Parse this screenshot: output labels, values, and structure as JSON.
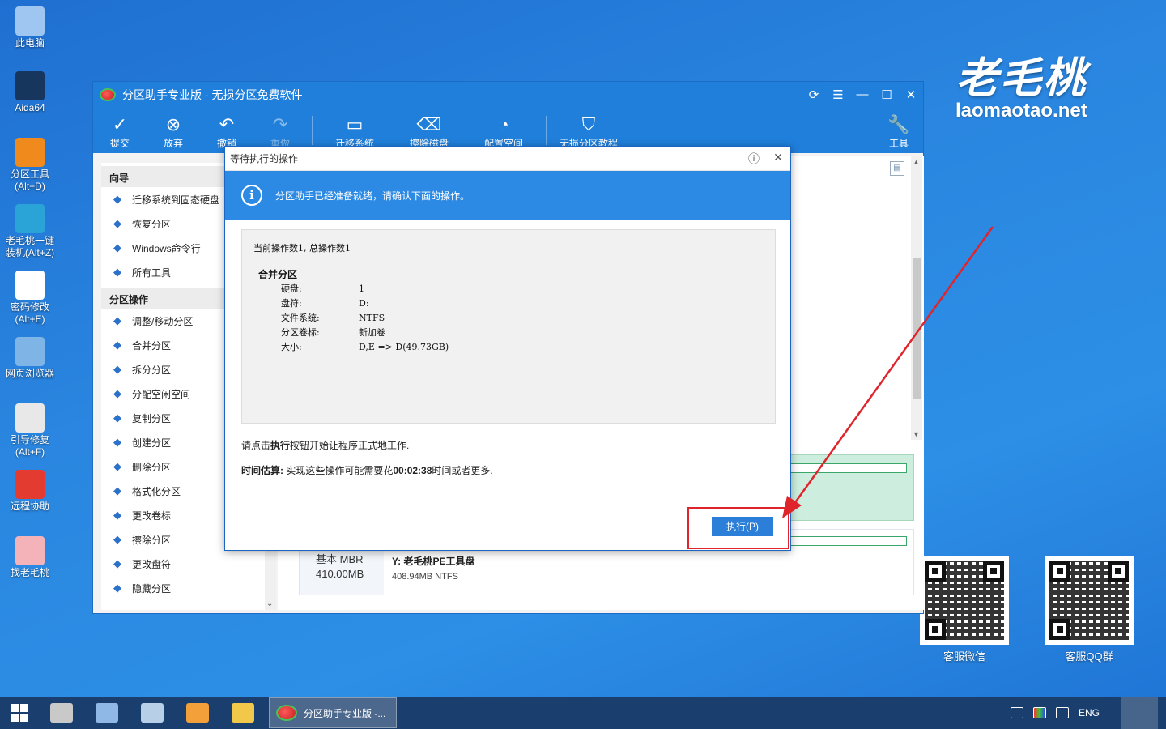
{
  "desktop": {
    "icons": [
      {
        "label": "此电脑",
        "icon": "computer-icon",
        "color": "#9ec6f0"
      },
      {
        "label": "Aida64",
        "icon": "aida64-icon",
        "color": "#16365e"
      },
      {
        "label": "分区工具\n(Alt+D)",
        "icon": "partition-tool-icon",
        "color": "#f08a1c"
      },
      {
        "label": "老毛桃一键\n装机(Alt+Z)",
        "icon": "installer-icon",
        "color": "#2aa3d6"
      },
      {
        "label": "密码修改\n(Alt+E)",
        "icon": "password-icon",
        "color": "#ffffff"
      },
      {
        "label": "网页浏览器",
        "icon": "browser-icon",
        "color": "#7fb4e6"
      },
      {
        "label": "引导修复\n(Alt+F)",
        "icon": "boot-repair-icon",
        "color": "#e8e8e8"
      },
      {
        "label": "远程协助",
        "icon": "remote-icon",
        "color": "#e33b2f"
      },
      {
        "label": "找老毛桃",
        "icon": "peach-icon",
        "color": "#f4b3b8"
      }
    ]
  },
  "brand": {
    "logo_text": "老毛桃",
    "site": "laomaotao.net"
  },
  "qr": [
    {
      "label": "客服微信"
    },
    {
      "label": "客服QQ群"
    }
  ],
  "window": {
    "title": "分区助手专业版 - 无损分区免费软件",
    "toolbar": [
      {
        "label": "提交",
        "icon": "check-icon"
      },
      {
        "label": "放弃",
        "icon": "discard-icon"
      },
      {
        "label": "撤销",
        "icon": "undo-icon"
      },
      {
        "label": "重做",
        "icon": "redo-icon"
      },
      {
        "label": "迁移系统",
        "icon": "migrate-os-icon"
      },
      {
        "label": "擦除磁盘",
        "icon": "wipe-disk-icon"
      },
      {
        "label": "配置空间",
        "icon": "allocate-space-icon"
      },
      {
        "label": "无损分区教程",
        "icon": "shield-icon"
      }
    ],
    "tools_label": "工具",
    "sidebar": {
      "wizard_header": "向导",
      "wizard_items": [
        "迁移系统到固态硬盘",
        "恢复分区",
        "Windows命令行",
        "所有工具"
      ],
      "ops_header": "分区操作",
      "ops_items": [
        "调整/移动分区",
        "合并分区",
        "拆分分区",
        "分配空闲空间",
        "复制分区",
        "创建分区",
        "删除分区",
        "格式化分区",
        "更改卷标",
        "擦除分区",
        "更改盘符",
        "隐藏分区"
      ]
    },
    "disk2": {
      "type": "基本 MBR",
      "size": "410.00MB",
      "partition_name": "Y: 老毛桃PE工具盘",
      "partition_info": "408.94MB NTFS"
    }
  },
  "dialog": {
    "title": "等待执行的操作",
    "banner": "分区助手已经准备就绪，请确认下面的操作。",
    "count_line": "当前操作数1, 总操作数1",
    "operation": "合并分区",
    "details": [
      {
        "key": "硬盘:",
        "value": "1"
      },
      {
        "key": "盘符:",
        "value": "D:"
      },
      {
        "key": "文件系统:",
        "value": "NTFS"
      },
      {
        "key": "分区卷标:",
        "value": "新加卷"
      },
      {
        "key": "大小:",
        "value": "D,E => D(49.73GB)"
      }
    ],
    "note_pre": "请点击",
    "note_bold": "执行",
    "note_post": "按钮开始让程序正式地工作.",
    "time_label": "时间估算:",
    "time_pre": " 实现这些操作可能需要花",
    "time_value": "00:02:38",
    "time_post": "时间或者更多.",
    "execute_label": "执行(P)"
  },
  "taskbar": {
    "task_label": "分区助手专业版 -...",
    "lang": "ENG"
  }
}
